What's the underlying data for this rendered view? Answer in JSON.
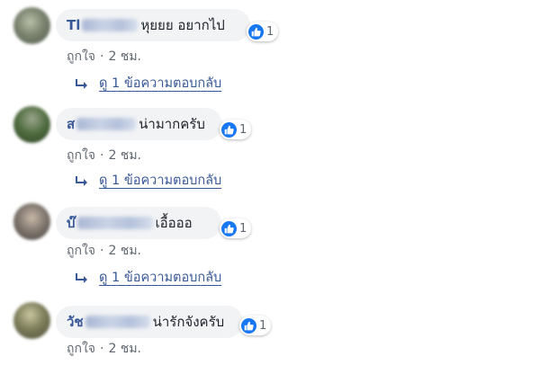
{
  "colors": {
    "like_blue": "#1877f2",
    "link": "#385898",
    "meta": "#606770",
    "bubble": "#f2f3f5"
  },
  "icons": {
    "reaction": "like-thumbs-up-icon",
    "reply": "reply-arrow-icon"
  },
  "comments": [
    {
      "name_visible": "Tl",
      "text": "หุยยย อยากไป",
      "reaction_count": "1",
      "like_action": "ถูกใจ",
      "separator": "·",
      "time": "2 ชม.",
      "reply_link": "ดู 1 ข้อความตอบกลับ"
    },
    {
      "name_visible": "ส",
      "text": "น่ามากครับ",
      "reaction_count": "1",
      "like_action": "ถูกใจ",
      "separator": "·",
      "time": "2 ชม.",
      "reply_link": "ดู 1 ข้อความตอบกลับ"
    },
    {
      "name_visible": "บ๊",
      "text": "เอื้อออ",
      "reaction_count": "1",
      "like_action": "ถูกใจ",
      "separator": "·",
      "time": "2 ชม.",
      "reply_link": "ดู 1 ข้อความตอบกลับ"
    },
    {
      "name_visible": "วัช",
      "text": "น่ารักจังครับ",
      "reaction_count": "1",
      "like_action": "ถูกใจ",
      "separator": "·",
      "time": "2 ชม."
    }
  ]
}
